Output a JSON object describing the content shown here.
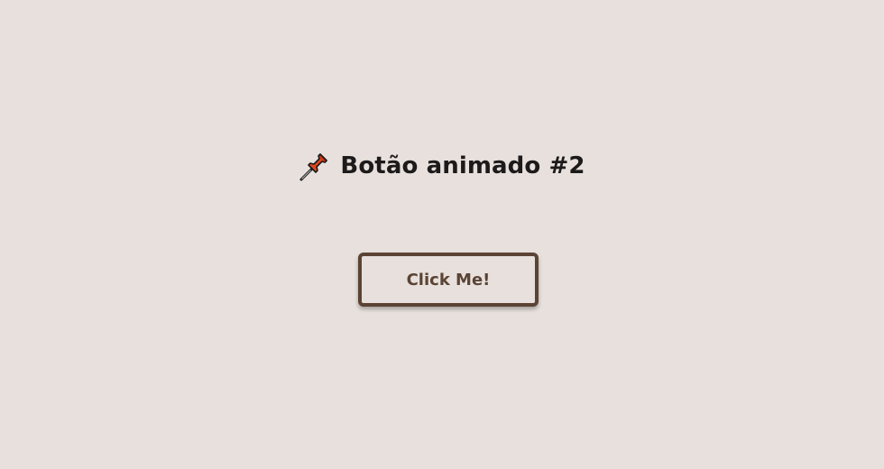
{
  "heading": {
    "icon": "pushpin-icon",
    "text": "Botão animado #2"
  },
  "button": {
    "label": "Click Me!"
  },
  "colors": {
    "background": "#e7e0dc",
    "heading_text": "#1c1a1a",
    "button_border": "#5b4335",
    "button_text": "#5b4335",
    "pin_red": "#e2441f"
  }
}
